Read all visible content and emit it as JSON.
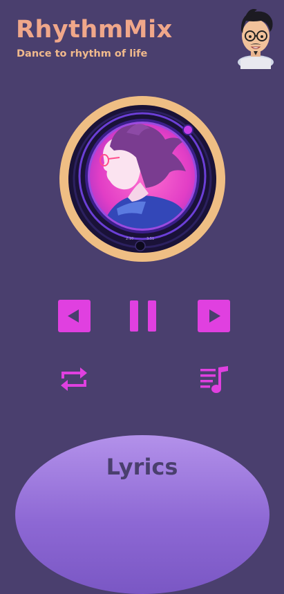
{
  "header": {
    "app_title": "RhythmMix",
    "tagline": "Dance to rhythm of life",
    "avatar_icon": "profile-avatar"
  },
  "player": {
    "album_art_icon": "album-art-disc",
    "progress_fraction": 0.03
  },
  "controls": {
    "prev_icon": "skip-previous-icon",
    "pause_icon": "pause-icon",
    "next_icon": "skip-next-icon",
    "repeat_icon": "repeat-icon",
    "queue_icon": "playlist-music-icon"
  },
  "lyrics": {
    "label": "Lyrics"
  },
  "colors": {
    "background": "#4a3f6e",
    "accent": "#e040e0",
    "title": "#f0a78a",
    "ring": "#efbe84",
    "lyrics_panel": "#9b78dc"
  }
}
